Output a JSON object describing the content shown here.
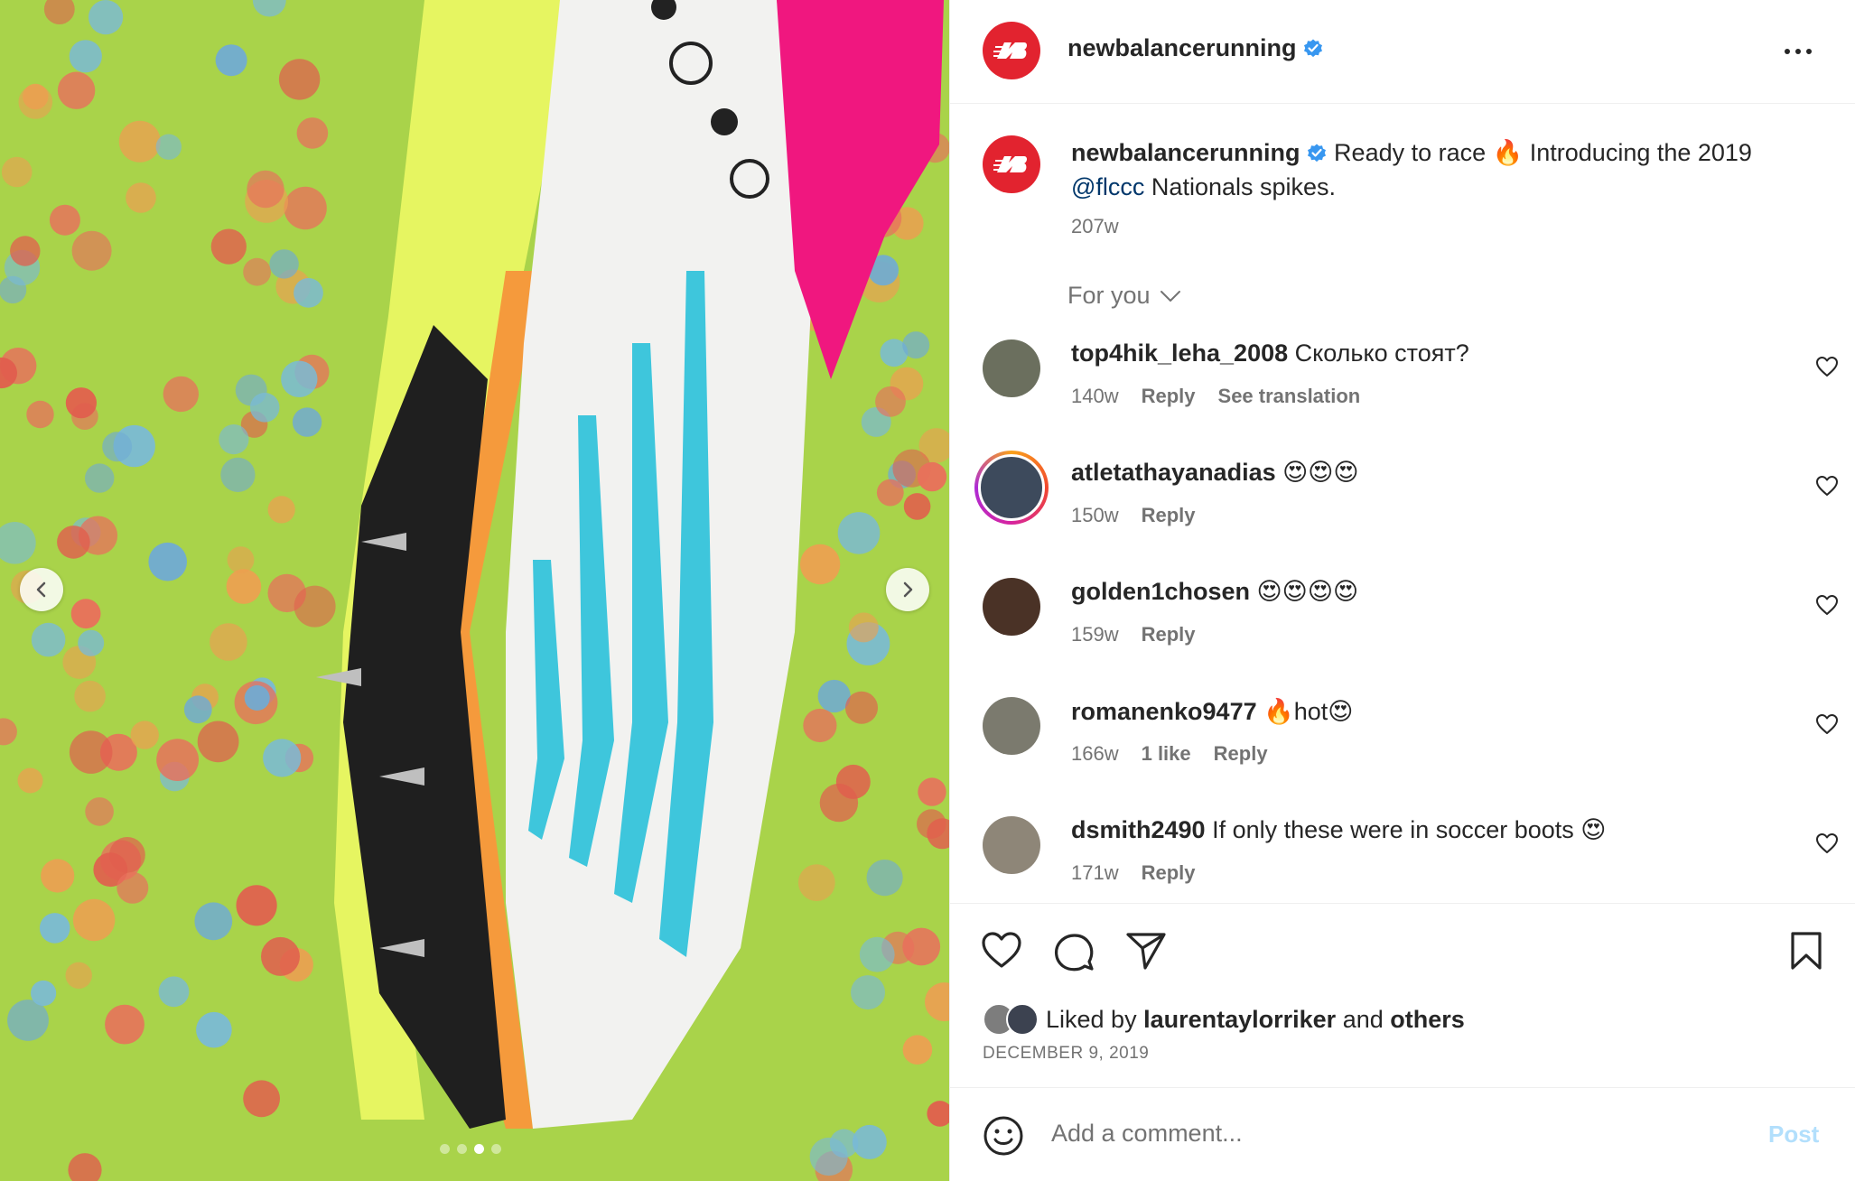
{
  "post": {
    "username": "newbalancerunning",
    "caption": {
      "username": "newbalancerunning",
      "text_before": " Ready to race 🔥 Introducing the 2019 ",
      "mention": "@flccc",
      "text_after": " Nationals spikes.",
      "age": "207w"
    },
    "sort_label": "For you",
    "carousel": {
      "count": 4,
      "active_index": 2
    }
  },
  "comments": [
    {
      "username": "top4hik_leha_2008",
      "text": " Сколько стоят?",
      "age": "140w",
      "likes": "",
      "reply": "Reply",
      "translate": "See translation",
      "ring": false,
      "avatar_color": "#6b6f5e"
    },
    {
      "username": "atletathayanadias",
      "text": " 😍😍😍",
      "age": "150w",
      "likes": "",
      "reply": "Reply",
      "translate": "",
      "ring": true,
      "avatar_color": "#3d4a5c"
    },
    {
      "username": "golden1chosen",
      "text": " 😍😍😍😍",
      "age": "159w",
      "likes": "",
      "reply": "Reply",
      "translate": "",
      "ring": false,
      "avatar_color": "#4a3226"
    },
    {
      "username": "romanenko9477",
      "text": " 🔥hot😍",
      "age": "166w",
      "likes": "1 like",
      "reply": "Reply",
      "translate": "",
      "ring": false,
      "avatar_color": "#7b7a6e"
    },
    {
      "username": "dsmith2490",
      "text": " If only these were in soccer boots 😍",
      "age": "171w",
      "likes": "",
      "reply": "Reply",
      "translate": "",
      "ring": false,
      "avatar_color": "#8e8678"
    }
  ],
  "likes": {
    "prefix": "Liked by ",
    "user": "laurentaylorriker",
    "middle": " and ",
    "others": "others"
  },
  "date": "DECEMBER 9, 2019",
  "add_comment": {
    "placeholder": "Add a comment...",
    "post_label": "Post"
  },
  "icons": {
    "header_more": "more-icon",
    "like": "heart-icon",
    "comment": "comment-icon",
    "share": "share-icon",
    "save": "bookmark-icon",
    "emoji": "emoji-icon"
  },
  "colors": {
    "brand_red": "#e2232f",
    "verified_blue": "#3897f0",
    "mention": "#00376b",
    "muted": "#737373",
    "post_disabled": "#b2dffc"
  }
}
